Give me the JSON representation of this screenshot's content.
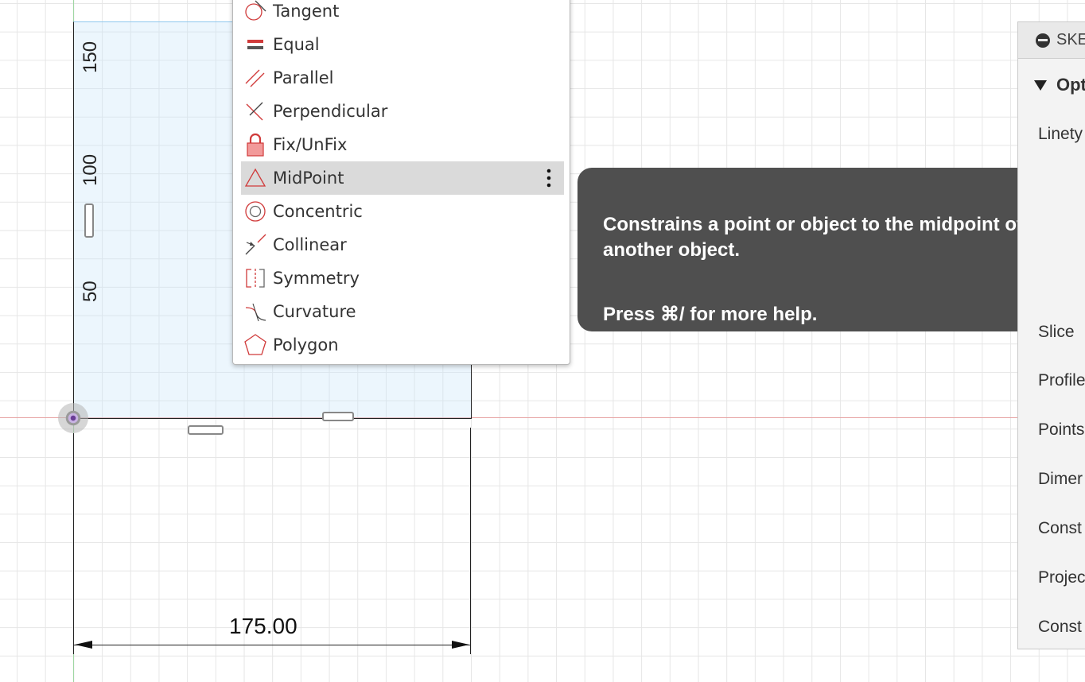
{
  "canvas": {
    "dimension_value": "175.00",
    "vertical_ticks": [
      "150",
      "100",
      "50"
    ]
  },
  "menu": {
    "items": [
      {
        "label": "Tangent",
        "icon": "tangent-icon"
      },
      {
        "label": "Equal",
        "icon": "equal-icon"
      },
      {
        "label": "Parallel",
        "icon": "parallel-icon"
      },
      {
        "label": "Perpendicular",
        "icon": "perpendicular-icon"
      },
      {
        "label": "Fix/UnFix",
        "icon": "lock-icon"
      },
      {
        "label": "MidPoint",
        "icon": "midpoint-icon",
        "highlighted": true
      },
      {
        "label": "Concentric",
        "icon": "concentric-icon"
      },
      {
        "label": "Collinear",
        "icon": "collinear-icon"
      },
      {
        "label": "Symmetry",
        "icon": "symmetry-icon"
      },
      {
        "label": "Curvature",
        "icon": "curvature-icon"
      },
      {
        "label": "Polygon",
        "icon": "polygon-icon"
      }
    ]
  },
  "tooltip": {
    "description": "Constrains a point or object to the midpoint of another object.",
    "help": "Press ⌘/ for more help."
  },
  "panel": {
    "title": "SKE",
    "section": "Opt",
    "rows": [
      "Linety",
      "Slice",
      "Profile",
      "Points",
      "Dimer",
      "Const",
      "Projec",
      "Const"
    ]
  },
  "colors": {
    "accent_red": "#d03a3a",
    "tooltip_bg": "#4f4f4f",
    "highlight_bg": "#dadada"
  }
}
